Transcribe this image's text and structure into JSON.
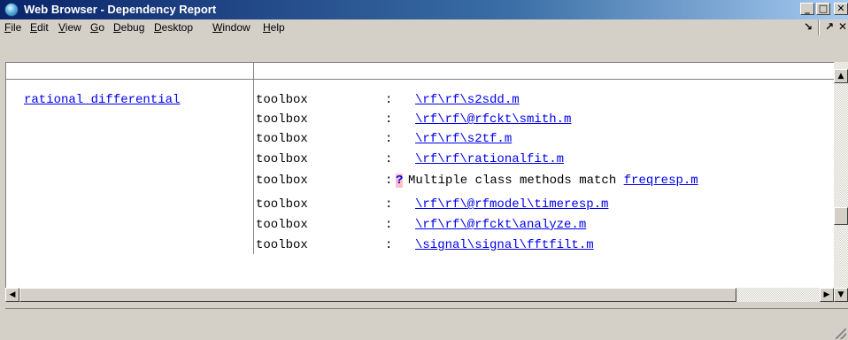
{
  "window": {
    "title": "Web Browser - Dependency Report"
  },
  "menu": {
    "file": "File",
    "edit": "Edit",
    "view": "View",
    "go": "Go",
    "debug": "Debug",
    "desktop": "Desktop",
    "window": "Window",
    "help": "Help"
  },
  "report": {
    "function_name": "rational differential",
    "rows": [
      {
        "type": "toolbox",
        "sep": ":",
        "link": "\\rf\\rf\\s2sdd.m"
      },
      {
        "type": "toolbox",
        "sep": ":",
        "link": "\\rf\\rf\\@rfckt\\smith.m"
      },
      {
        "type": "toolbox",
        "sep": ":",
        "link": "\\rf\\rf\\s2tf.m"
      },
      {
        "type": "toolbox",
        "sep": ":",
        "link": "\\rf\\rf\\rationalfit.m"
      },
      {
        "type": "toolbox",
        "sep": ":",
        "qmark": "?",
        "message": "Multiple class methods match",
        "message_link": "freqresp.m"
      },
      {
        "type": "toolbox",
        "sep": ":",
        "link": "\\rf\\rf\\@rfmodel\\timeresp.m"
      },
      {
        "type": "toolbox",
        "sep": ":",
        "link": "\\rf\\rf\\@rfckt\\analyze.m"
      },
      {
        "type": "toolbox",
        "sep": ":",
        "link": "\\signal\\signal\\fftfilt.m"
      }
    ]
  },
  "icons": {
    "app": "matlab-web-browser-icon",
    "minimize": "minimize-icon",
    "maximize": "maximize-icon",
    "close": "close-icon",
    "undock": "undock-arrow-icon",
    "unpin": "pin-arrow-icon",
    "panel_close": "close-icon"
  }
}
